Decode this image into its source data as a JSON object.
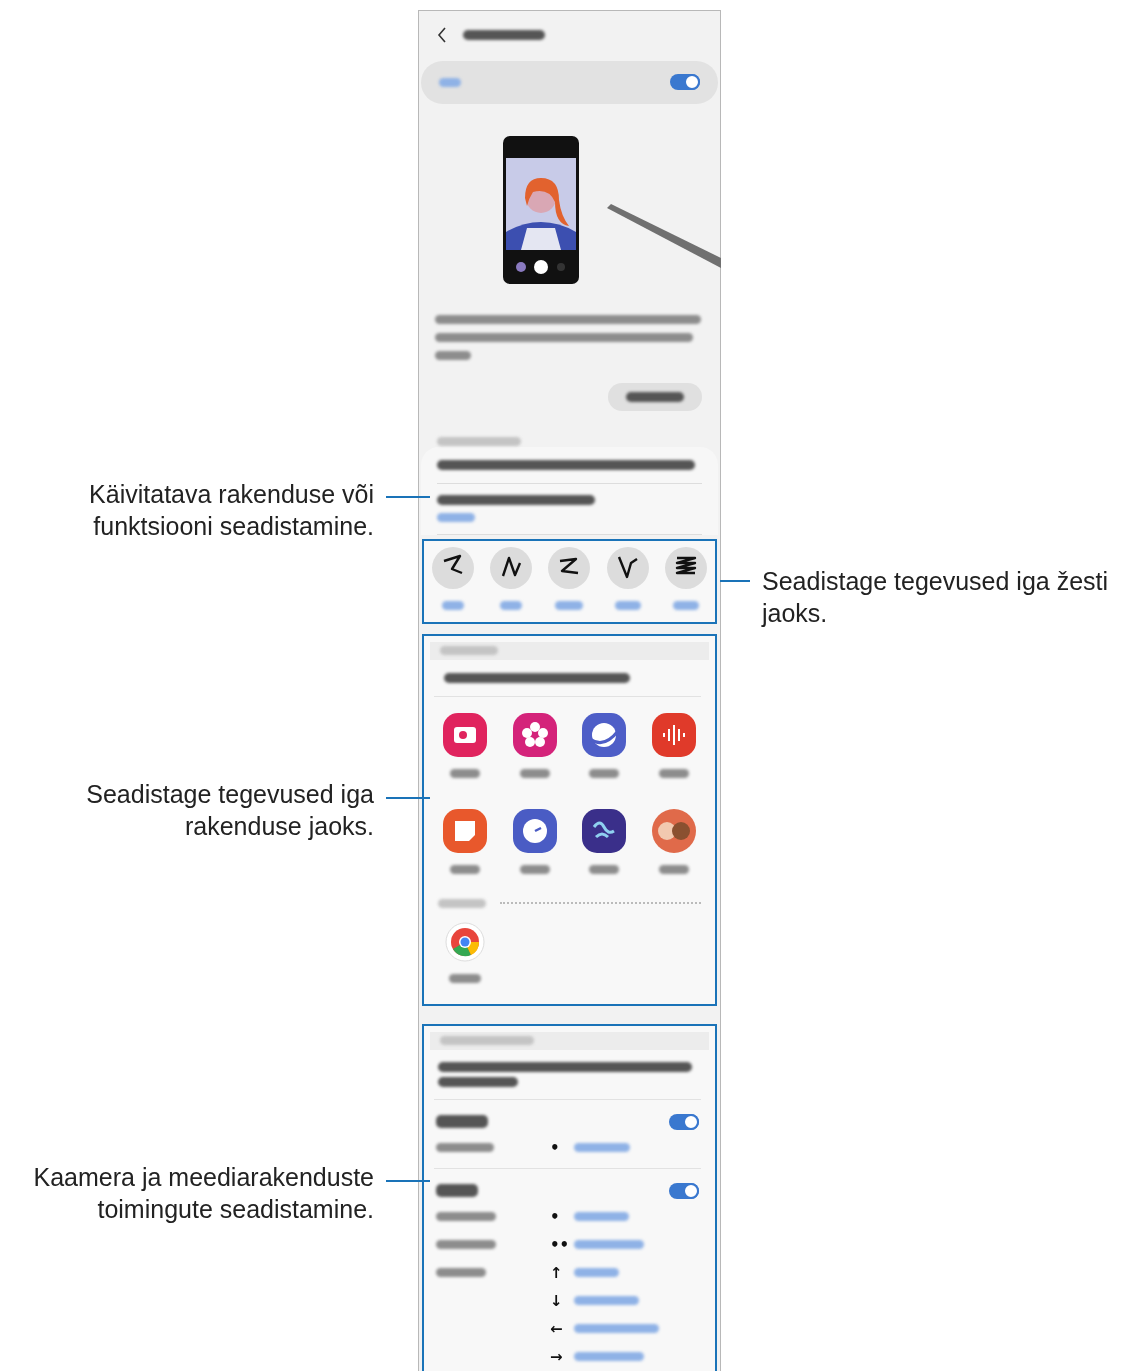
{
  "callouts": [
    {
      "kind": "left",
      "text": "Käivitatava rakenduse või funktsiooni seadistamine."
    },
    {
      "kind": "right",
      "text": "Seadistage tegevused iga žesti jaoks."
    },
    {
      "kind": "left",
      "text": "Seadistage tegevused iga rakenduse jaoks."
    },
    {
      "kind": "left",
      "text": "Kaamera ja meediarakenduste toimingute seadistamine."
    }
  ],
  "screen": {
    "master_toggle": {
      "on": true
    },
    "camera": {
      "toggle": {
        "on": true
      },
      "actions": [
        "•"
      ]
    },
    "media": {
      "toggle": {
        "on": true
      },
      "actions": [
        "•",
        "••",
        "↑",
        "↓",
        "←",
        "→"
      ]
    }
  }
}
